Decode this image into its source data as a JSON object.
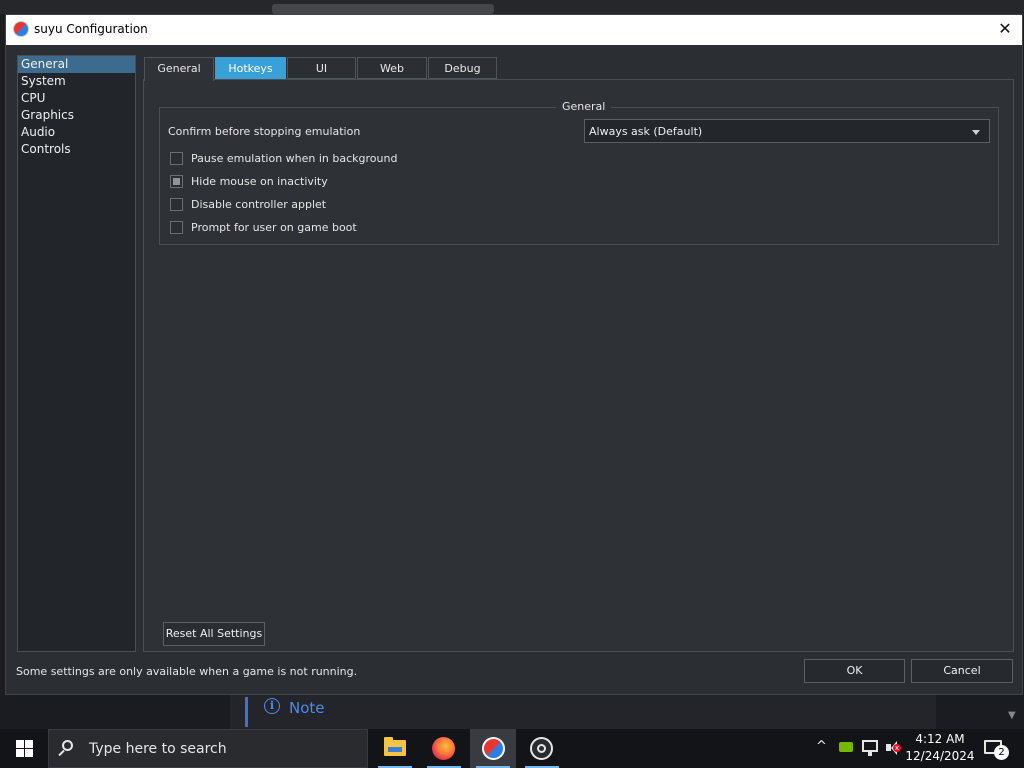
{
  "window": {
    "title": "suyu Configuration",
    "close_glyph": "✕"
  },
  "sidebar": {
    "items": [
      {
        "label": "General",
        "selected": true
      },
      {
        "label": "System",
        "selected": false
      },
      {
        "label": "CPU",
        "selected": false
      },
      {
        "label": "Graphics",
        "selected": false
      },
      {
        "label": "Audio",
        "selected": false
      },
      {
        "label": "Controls",
        "selected": false
      }
    ]
  },
  "tabs": [
    {
      "label": "General",
      "selected": true
    },
    {
      "label": "Hotkeys",
      "hovered": true
    },
    {
      "label": "UI"
    },
    {
      "label": "Web"
    },
    {
      "label": "Debug"
    }
  ],
  "general": {
    "group_title": "General",
    "confirm_label": "Confirm before stopping emulation",
    "confirm_value": "Always ask (Default)",
    "checkboxes": [
      {
        "label": "Pause emulation when in background",
        "checked": false
      },
      {
        "label": "Hide mouse on inactivity",
        "checked": true
      },
      {
        "label": "Disable controller applet",
        "checked": false
      },
      {
        "label": "Prompt for user on game boot",
        "checked": false
      }
    ],
    "reset_label": "Reset All Settings"
  },
  "footer": {
    "note": "Some settings are only available when a game is not running.",
    "ok_label": "OK",
    "cancel_label": "Cancel"
  },
  "background": {
    "note_icon": "i",
    "note_text": "Note"
  },
  "taskbar": {
    "search_placeholder": "Type here to search",
    "apps": [
      "file-explorer",
      "firefox",
      "suyu",
      "obs-studio"
    ],
    "tray_chevron": "^",
    "time": "4:12 AM",
    "date": "12/24/2024",
    "notification_count": "2",
    "mute_glyph": "x"
  },
  "colors": {
    "window_bg": "#2b2f33",
    "selection": "#3c6b8d",
    "hover_tab": "#3aa1d8",
    "taskbar": "#131417"
  }
}
